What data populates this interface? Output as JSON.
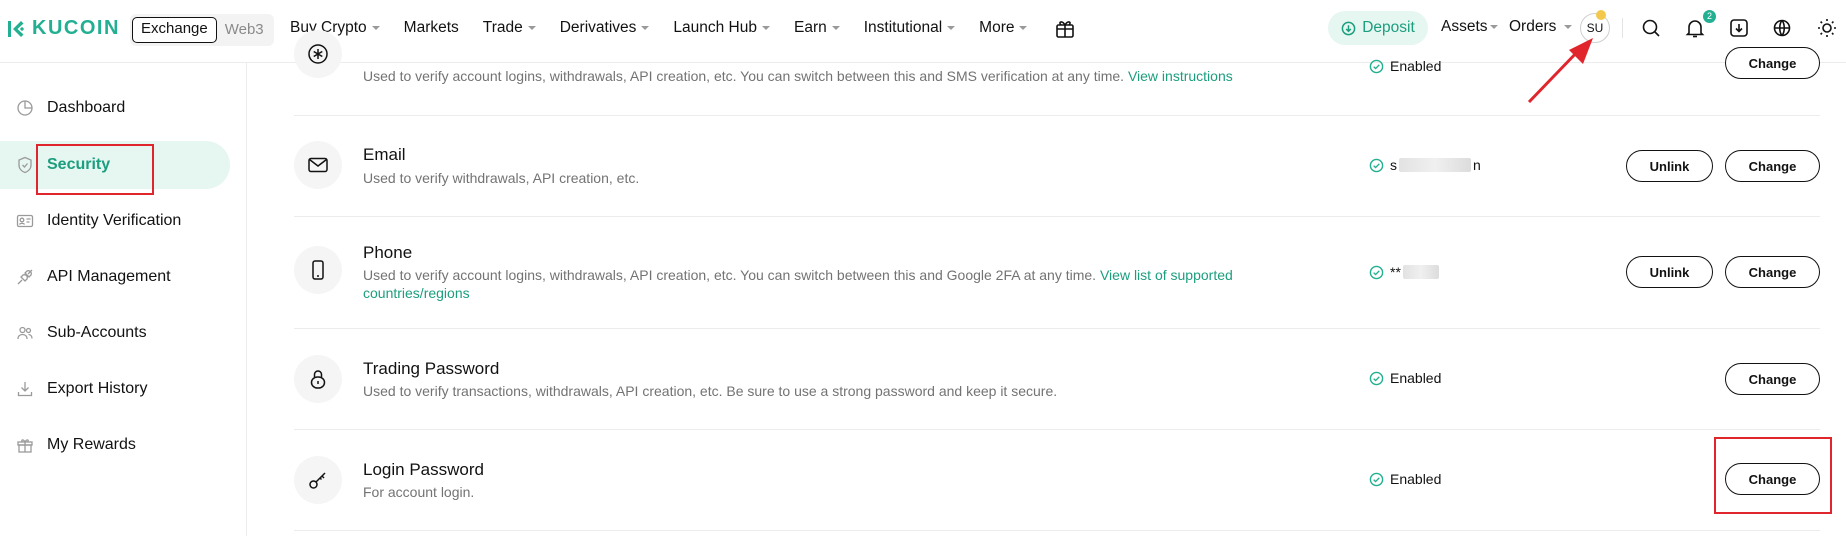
{
  "brand": {
    "name": "KUCOIN",
    "accent_color": "#23af91",
    "highlight_color": "#e0262c"
  },
  "exchange_toggle": {
    "active": "Exchange",
    "inactive": "Web3"
  },
  "nav": {
    "items": [
      {
        "label": "Buy Crypto",
        "dropdown": true
      },
      {
        "label": "Markets",
        "dropdown": false
      },
      {
        "label": "Trade",
        "dropdown": true
      },
      {
        "label": "Derivatives",
        "dropdown": true
      },
      {
        "label": "Launch Hub",
        "dropdown": true
      },
      {
        "label": "Earn",
        "dropdown": true
      },
      {
        "label": "Institutional",
        "dropdown": true
      },
      {
        "label": "More",
        "dropdown": true
      }
    ]
  },
  "top_right": {
    "deposit": "Deposit",
    "assets": "Assets",
    "orders": "Orders",
    "avatar": "SU",
    "notification_count": "2",
    "icons": [
      "search-icon",
      "bell-icon",
      "download-icon",
      "globe-icon",
      "theme-icon"
    ]
  },
  "sidebar": {
    "items": [
      {
        "label": "Dashboard",
        "icon": "dashboard-icon"
      },
      {
        "label": "Security",
        "icon": "shield-icon",
        "active": true
      },
      {
        "label": "Identity Verification",
        "icon": "id-card-icon"
      },
      {
        "label": "API Management",
        "icon": "api-icon"
      },
      {
        "label": "Sub-Accounts",
        "icon": "users-icon"
      },
      {
        "label": "Export History",
        "icon": "export-icon"
      },
      {
        "label": "My Rewards",
        "icon": "gift-icon"
      }
    ]
  },
  "security_rows": {
    "google": {
      "desc": "Used to verify account logins, withdrawals, API creation, etc. You can switch between this and SMS verification at any time.",
      "link": "View instructions",
      "status": "Enabled",
      "change": "Change"
    },
    "email": {
      "title": "Email",
      "desc": "Used to verify withdrawals, API creation, etc.",
      "status_prefix": "s",
      "status_suffix": "n",
      "unlink": "Unlink",
      "change": "Change"
    },
    "phone": {
      "title": "Phone",
      "desc": "Used to verify account logins, withdrawals, API creation, etc. You can switch between this and Google 2FA at any time.",
      "link_line1": "View list of supported",
      "link_line2": "countries/regions",
      "status_prefix": "**",
      "unlink": "Unlink",
      "change": "Change"
    },
    "trading_password": {
      "title": "Trading Password",
      "desc": "Used to verify transactions, withdrawals, API creation, etc. Be sure to use a strong password and keep it secure.",
      "status": "Enabled",
      "change": "Change"
    },
    "login_password": {
      "title": "Login Password",
      "desc": "For account login.",
      "status": "Enabled",
      "change": "Change"
    }
  }
}
